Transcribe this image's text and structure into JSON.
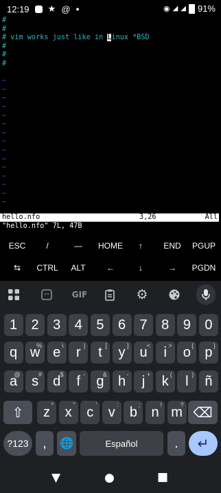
{
  "status_bar": {
    "time": "12:19",
    "battery": "91%",
    "notification_icons": [
      "mastodon-icon",
      "star-icon",
      "at-sign-icon",
      "dot-icon"
    ],
    "system_icons": [
      "hotspot-icon",
      "signal-4g-icon",
      "lte-signal-icon",
      "battery-icon"
    ]
  },
  "terminal": {
    "lines": [
      "#",
      "#",
      "# vim works just like in ",
      "#",
      "#",
      "#"
    ],
    "cursor_char": "L",
    "after_cursor": "inux *BSD",
    "tilde": "~",
    "tilde_count": 15,
    "status_filename": "hello.nfo",
    "status_position": "3,26",
    "status_scroll": "All",
    "message": "\"hello.nfo\" 7L, 47B"
  },
  "extra_keys": {
    "row1": [
      "ESC",
      "/",
      "—",
      "HOME",
      "↑",
      "END",
      "PGUP"
    ],
    "row2": [
      "⇆",
      "CTRL",
      "ALT",
      "←",
      "↓",
      "→",
      "PGDN"
    ]
  },
  "keyboard": {
    "toolbar_icons": [
      "apps-grid-icon",
      "sticker-icon",
      "gif-icon",
      "clipboard-icon",
      "settings-gear-icon",
      "palette-icon",
      "microphone-icon"
    ],
    "gif_label": "GIF",
    "number_row": [
      "1",
      "2",
      "3",
      "4",
      "5",
      "6",
      "7",
      "8",
      "9",
      "0"
    ],
    "row_q": [
      {
        "k": "q",
        "h": ""
      },
      {
        "k": "w",
        "h": "%"
      },
      {
        "k": "e",
        "h": "\\"
      },
      {
        "k": "r",
        "h": "|"
      },
      {
        "k": "t",
        "h": "["
      },
      {
        "k": "y",
        "h": "]"
      },
      {
        "k": "u",
        "h": "<"
      },
      {
        "k": "i",
        "h": ">"
      },
      {
        "k": "o",
        "h": "{"
      },
      {
        "k": "p",
        "h": "}"
      }
    ],
    "row_a": [
      {
        "k": "a",
        "h": "@"
      },
      {
        "k": "s",
        "h": "#"
      },
      {
        "k": "d",
        "h": "$"
      },
      {
        "k": "f",
        "h": "-"
      },
      {
        "k": "g",
        "h": "&"
      },
      {
        "k": "h",
        "h": "-"
      },
      {
        "k": "j",
        "h": "+"
      },
      {
        "k": "k",
        "h": "("
      },
      {
        "k": "l",
        "h": ")"
      },
      {
        "k": "ñ",
        "h": ""
      }
    ],
    "row_z": [
      {
        "k": "z",
        "h": "*"
      },
      {
        "k": "x",
        "h": "\""
      },
      {
        "k": "c",
        "h": "'"
      },
      {
        "k": "v",
        "h": ":"
      },
      {
        "k": "b",
        "h": ";"
      },
      {
        "k": "n",
        "h": "!"
      },
      {
        "k": "m",
        "h": "?"
      }
    ],
    "shift_glyph": "⇧",
    "backspace_glyph": "⌫",
    "symbols_label": "?123",
    "comma": ",",
    "globe_glyph": "🌐",
    "space_label": "Español",
    "period": ".",
    "enter_glyph": "↵"
  },
  "navigation": {
    "back": "▼",
    "home": "●",
    "recents": "■"
  }
}
